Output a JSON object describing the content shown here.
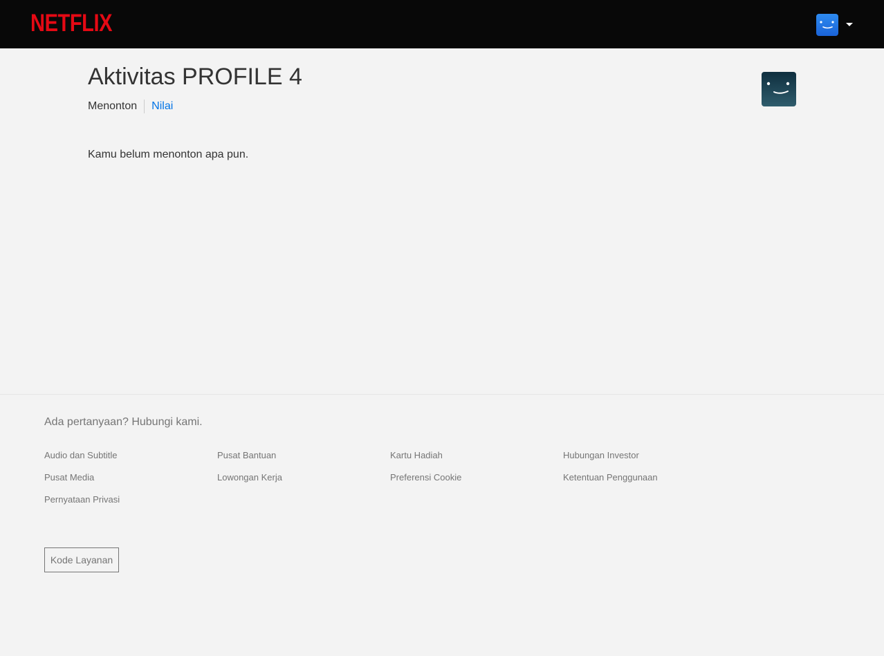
{
  "header": {
    "logo_text": "NETFLIX",
    "brand_color": "#e50914",
    "profile_icon": "smiley-face-icon",
    "menu_icon": "caret-down-icon"
  },
  "main": {
    "title": "Aktivitas PROFILE 4",
    "tabs": [
      {
        "label": "Menonton",
        "active": true
      },
      {
        "label": "Nilai",
        "active": false
      }
    ],
    "empty_message": "Kamu belum menonton apa pun.",
    "profile_avatar_icon": "smiley-face-icon"
  },
  "footer": {
    "question": "Ada pertanyaan? Hubungi kami.",
    "links": [
      "Audio dan Subtitle",
      "Pusat Bantuan",
      "Kartu Hadiah",
      "Hubungan Investor",
      "Pusat Media",
      "Lowongan Kerja",
      "Preferensi Cookie",
      "Ketentuan Penggunaan",
      "Pernyataan Privasi"
    ],
    "service_code_label": "Kode Layanan"
  }
}
